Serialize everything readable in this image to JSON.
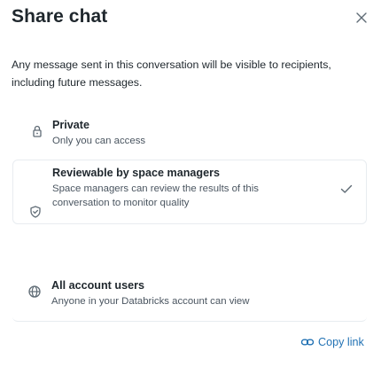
{
  "dialog": {
    "title": "Share chat",
    "description": "Any message sent in this conversation will be visible to recipients, including future messages.",
    "close_icon": "close-icon"
  },
  "options": [
    {
      "title": "Private",
      "subtitle": "Only you can access",
      "icon": "lock-icon",
      "selected": false
    },
    {
      "title": "Reviewable by space managers",
      "subtitle": "Space managers can review the results of this conversation to monitor quality",
      "icon": "shield-icon",
      "selected": true
    },
    {
      "title": "All account users",
      "subtitle": "Anyone in your Databricks account can view",
      "icon": "globe-icon",
      "selected": false
    }
  ],
  "footer": {
    "copy_link_label": "Copy link",
    "copy_link_icon": "link-icon"
  },
  "colors": {
    "text": "#1f272d",
    "muted": "#4a5560",
    "link": "#2272b4",
    "border": "#e8ecf0"
  }
}
